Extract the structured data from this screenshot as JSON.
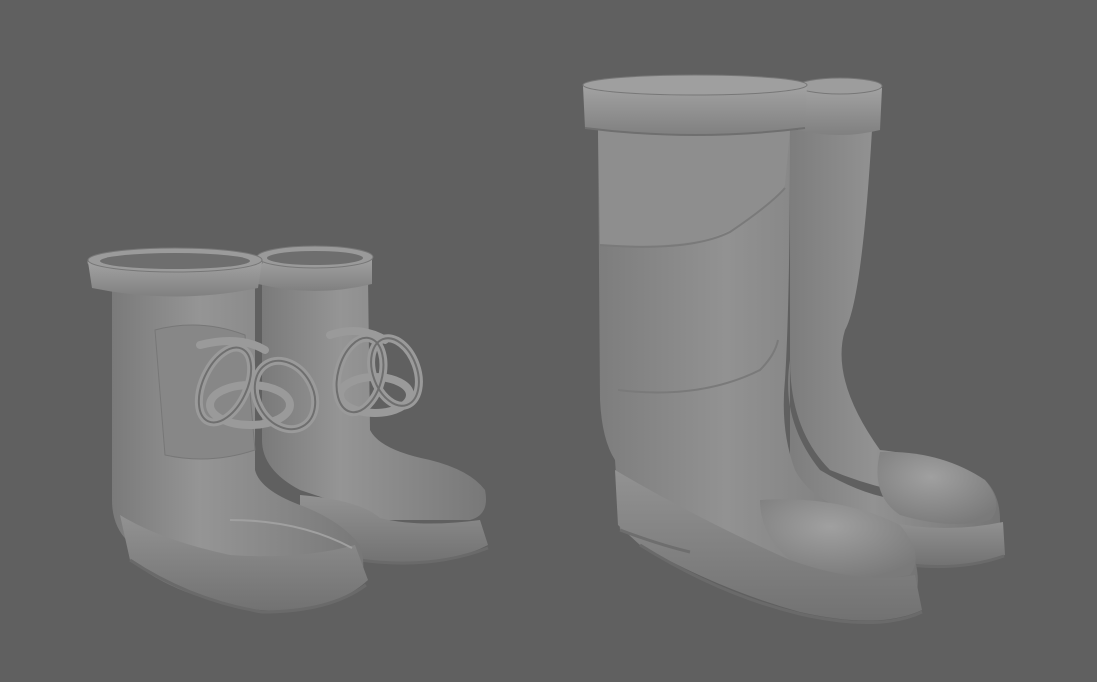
{
  "scene": {
    "background_color": "#606060",
    "objects": [
      {
        "name": "short-laced-rain-boots-pair",
        "count": 2,
        "has_laces": true
      },
      {
        "name": "tall-rain-boots-pair",
        "count": 2,
        "has_laces": false
      }
    ],
    "material": {
      "base_color": "#8a8a8a",
      "shadow_color": "#6a6a6a",
      "highlight_color": "#a6a6a6"
    }
  }
}
